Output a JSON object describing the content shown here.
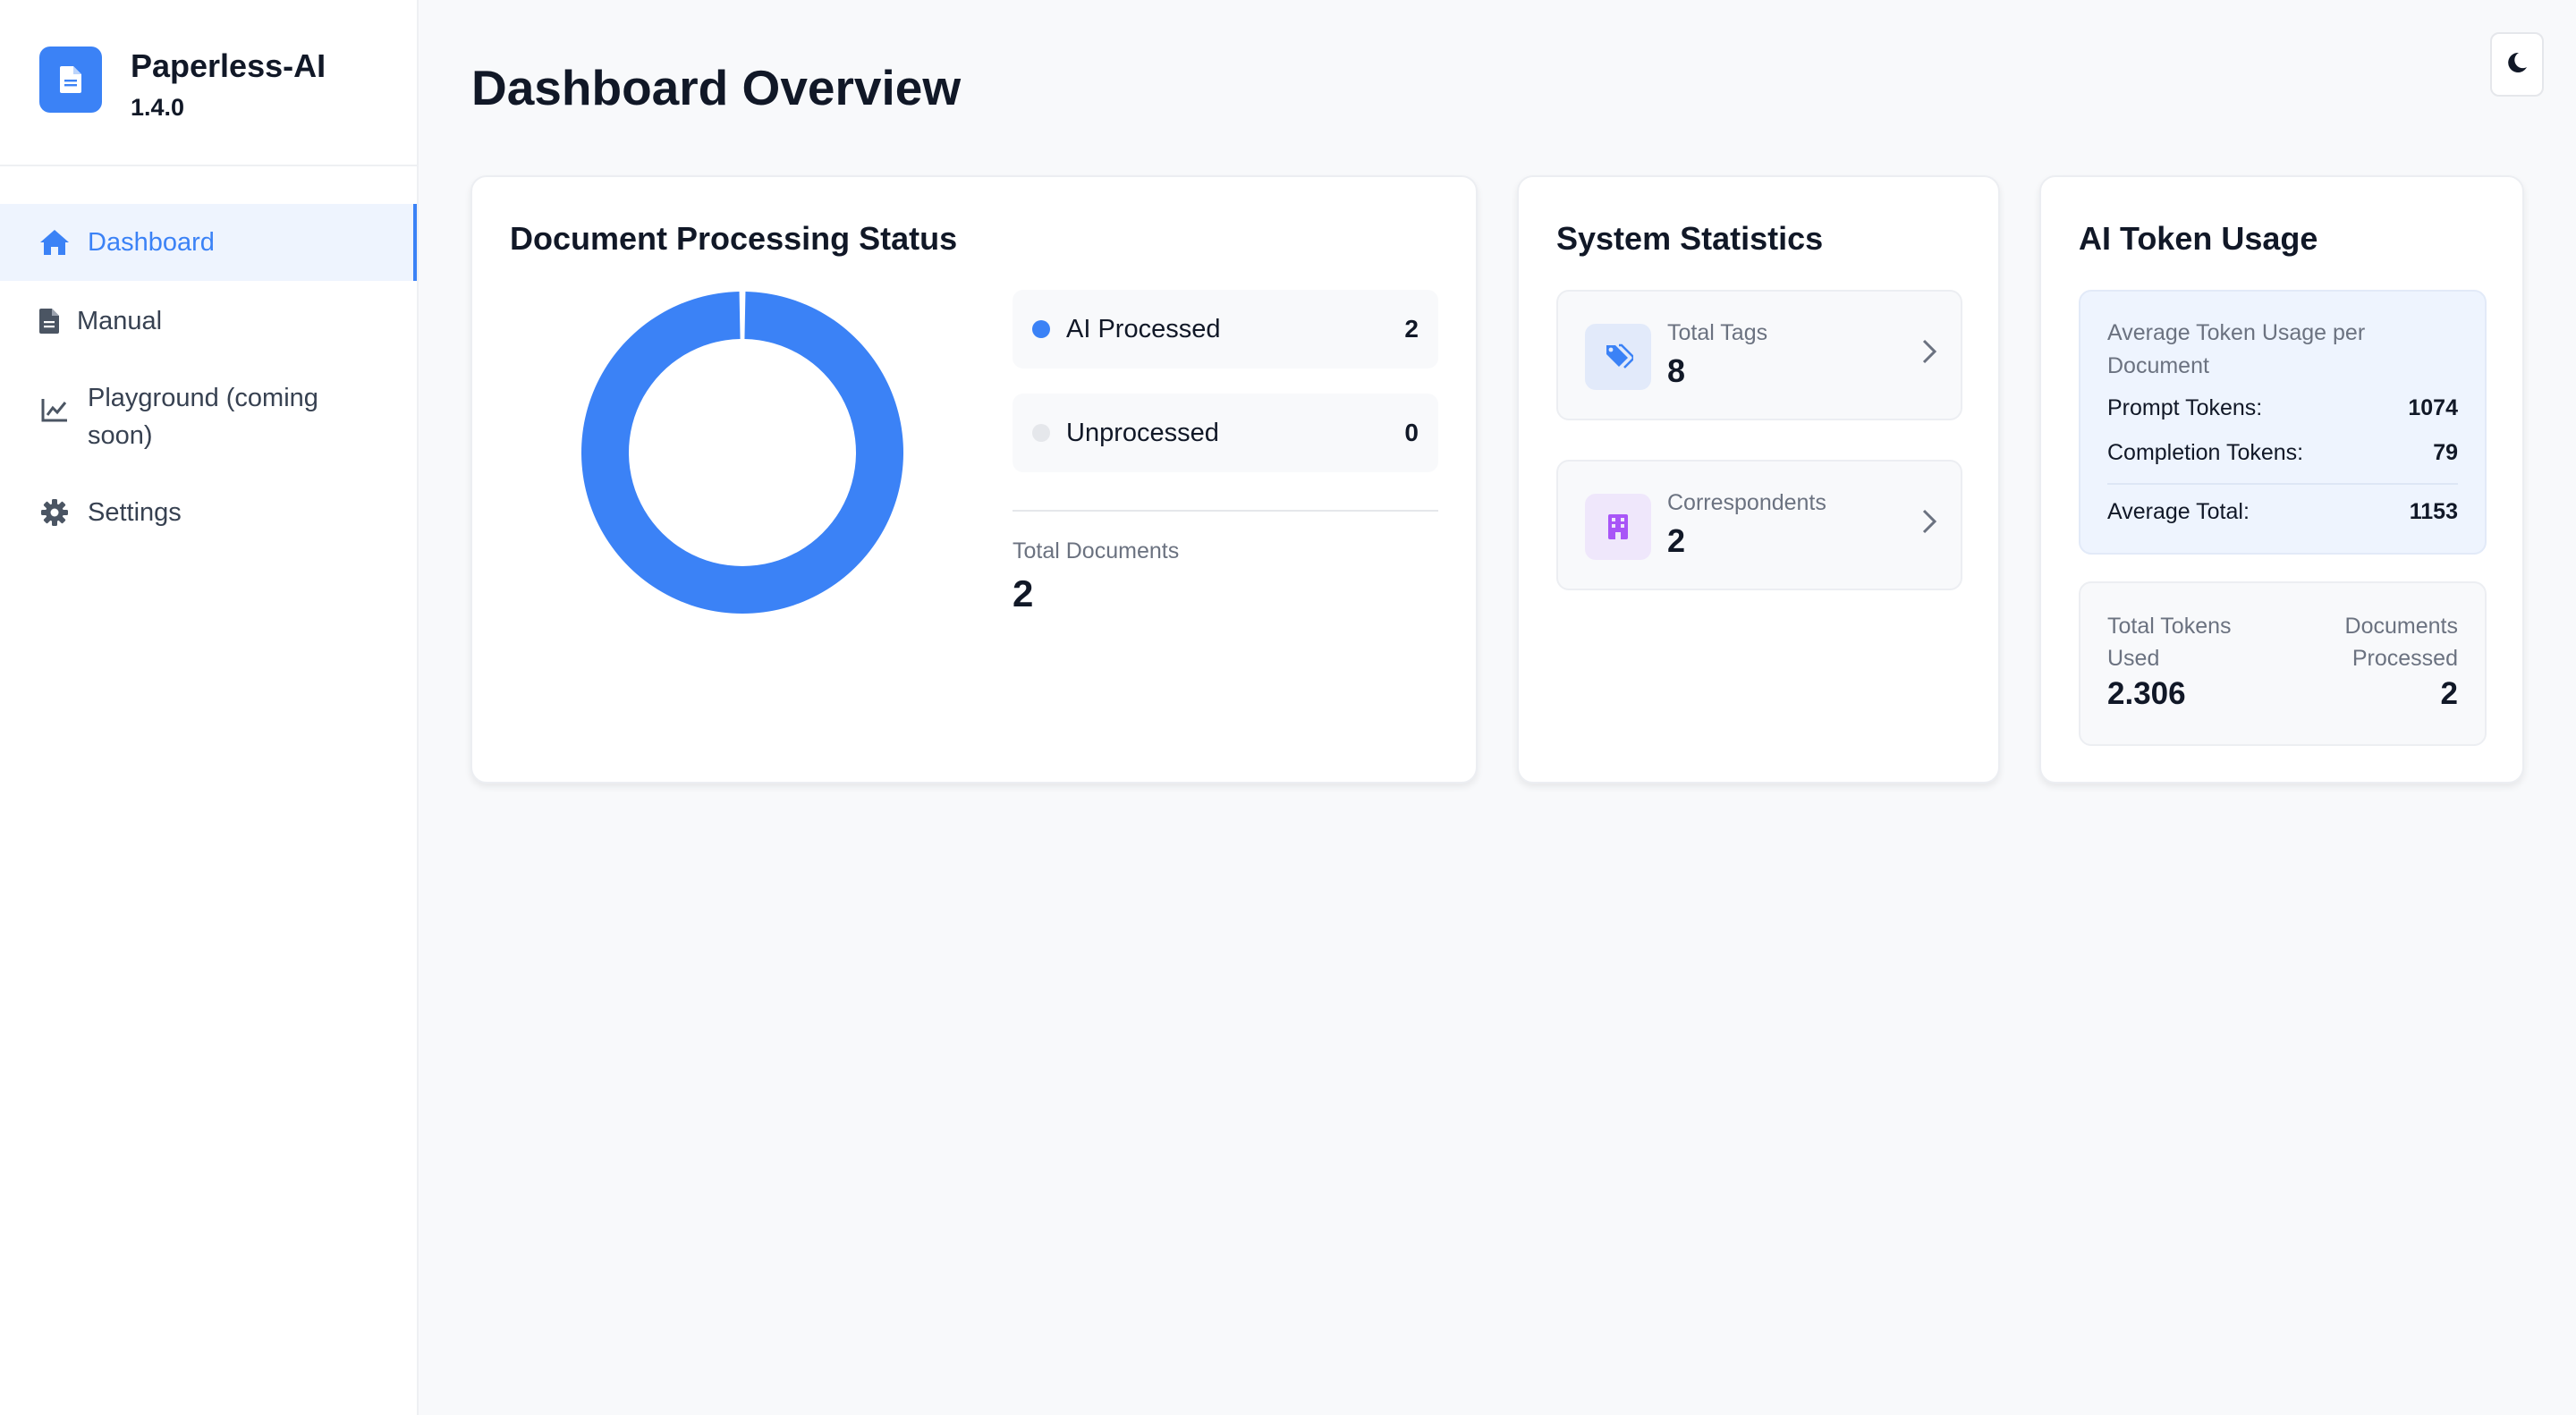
{
  "app": {
    "name": "Paperless-AI",
    "version": "1.4.0",
    "logo_icon": "document-icon"
  },
  "sidebar": {
    "items": [
      {
        "label": "Dashboard",
        "icon": "home-icon",
        "active": true
      },
      {
        "label": "Manual",
        "icon": "file-icon",
        "active": false
      },
      {
        "label": "Playground (coming soon)",
        "icon": "chart-line-icon",
        "active": false
      },
      {
        "label": "Settings",
        "icon": "gear-icon",
        "active": false
      }
    ]
  },
  "header": {
    "title": "Dashboard Overview",
    "theme_toggle_icon": "moon-icon"
  },
  "processing": {
    "title": "Document Processing Status",
    "legend": [
      {
        "label": "AI Processed",
        "value": "2",
        "color": "#3b82f6"
      },
      {
        "label": "Unprocessed",
        "value": "0",
        "color": "#e5e7eb"
      }
    ],
    "total_label": "Total Documents",
    "total_value": "2"
  },
  "chart_data": {
    "type": "pie",
    "categories": [
      "AI Processed",
      "Unprocessed"
    ],
    "values": [
      2,
      0
    ],
    "colors": [
      "#3b82f6",
      "#e5e7eb"
    ],
    "title": "Document Processing Status"
  },
  "stats": {
    "title": "System Statistics",
    "items": [
      {
        "label": "Total Tags",
        "value": "8",
        "icon": "tags-icon",
        "icon_color": "#3b82f6"
      },
      {
        "label": "Correspondents",
        "value": "2",
        "icon": "building-icon",
        "icon_color": "#a855f7"
      }
    ]
  },
  "tokens": {
    "title": "AI Token Usage",
    "avg_title": "Average Token Usage per Document",
    "prompt_label": "Prompt Tokens:",
    "prompt_value": "1074",
    "completion_label": "Completion Tokens:",
    "completion_value": "79",
    "avg_total_label": "Average Total:",
    "avg_total_value": "1153",
    "total_used_label": "Total Tokens Used",
    "total_used_value": "2.306",
    "docs_processed_label": "Documents Processed",
    "docs_processed_value": "2"
  }
}
